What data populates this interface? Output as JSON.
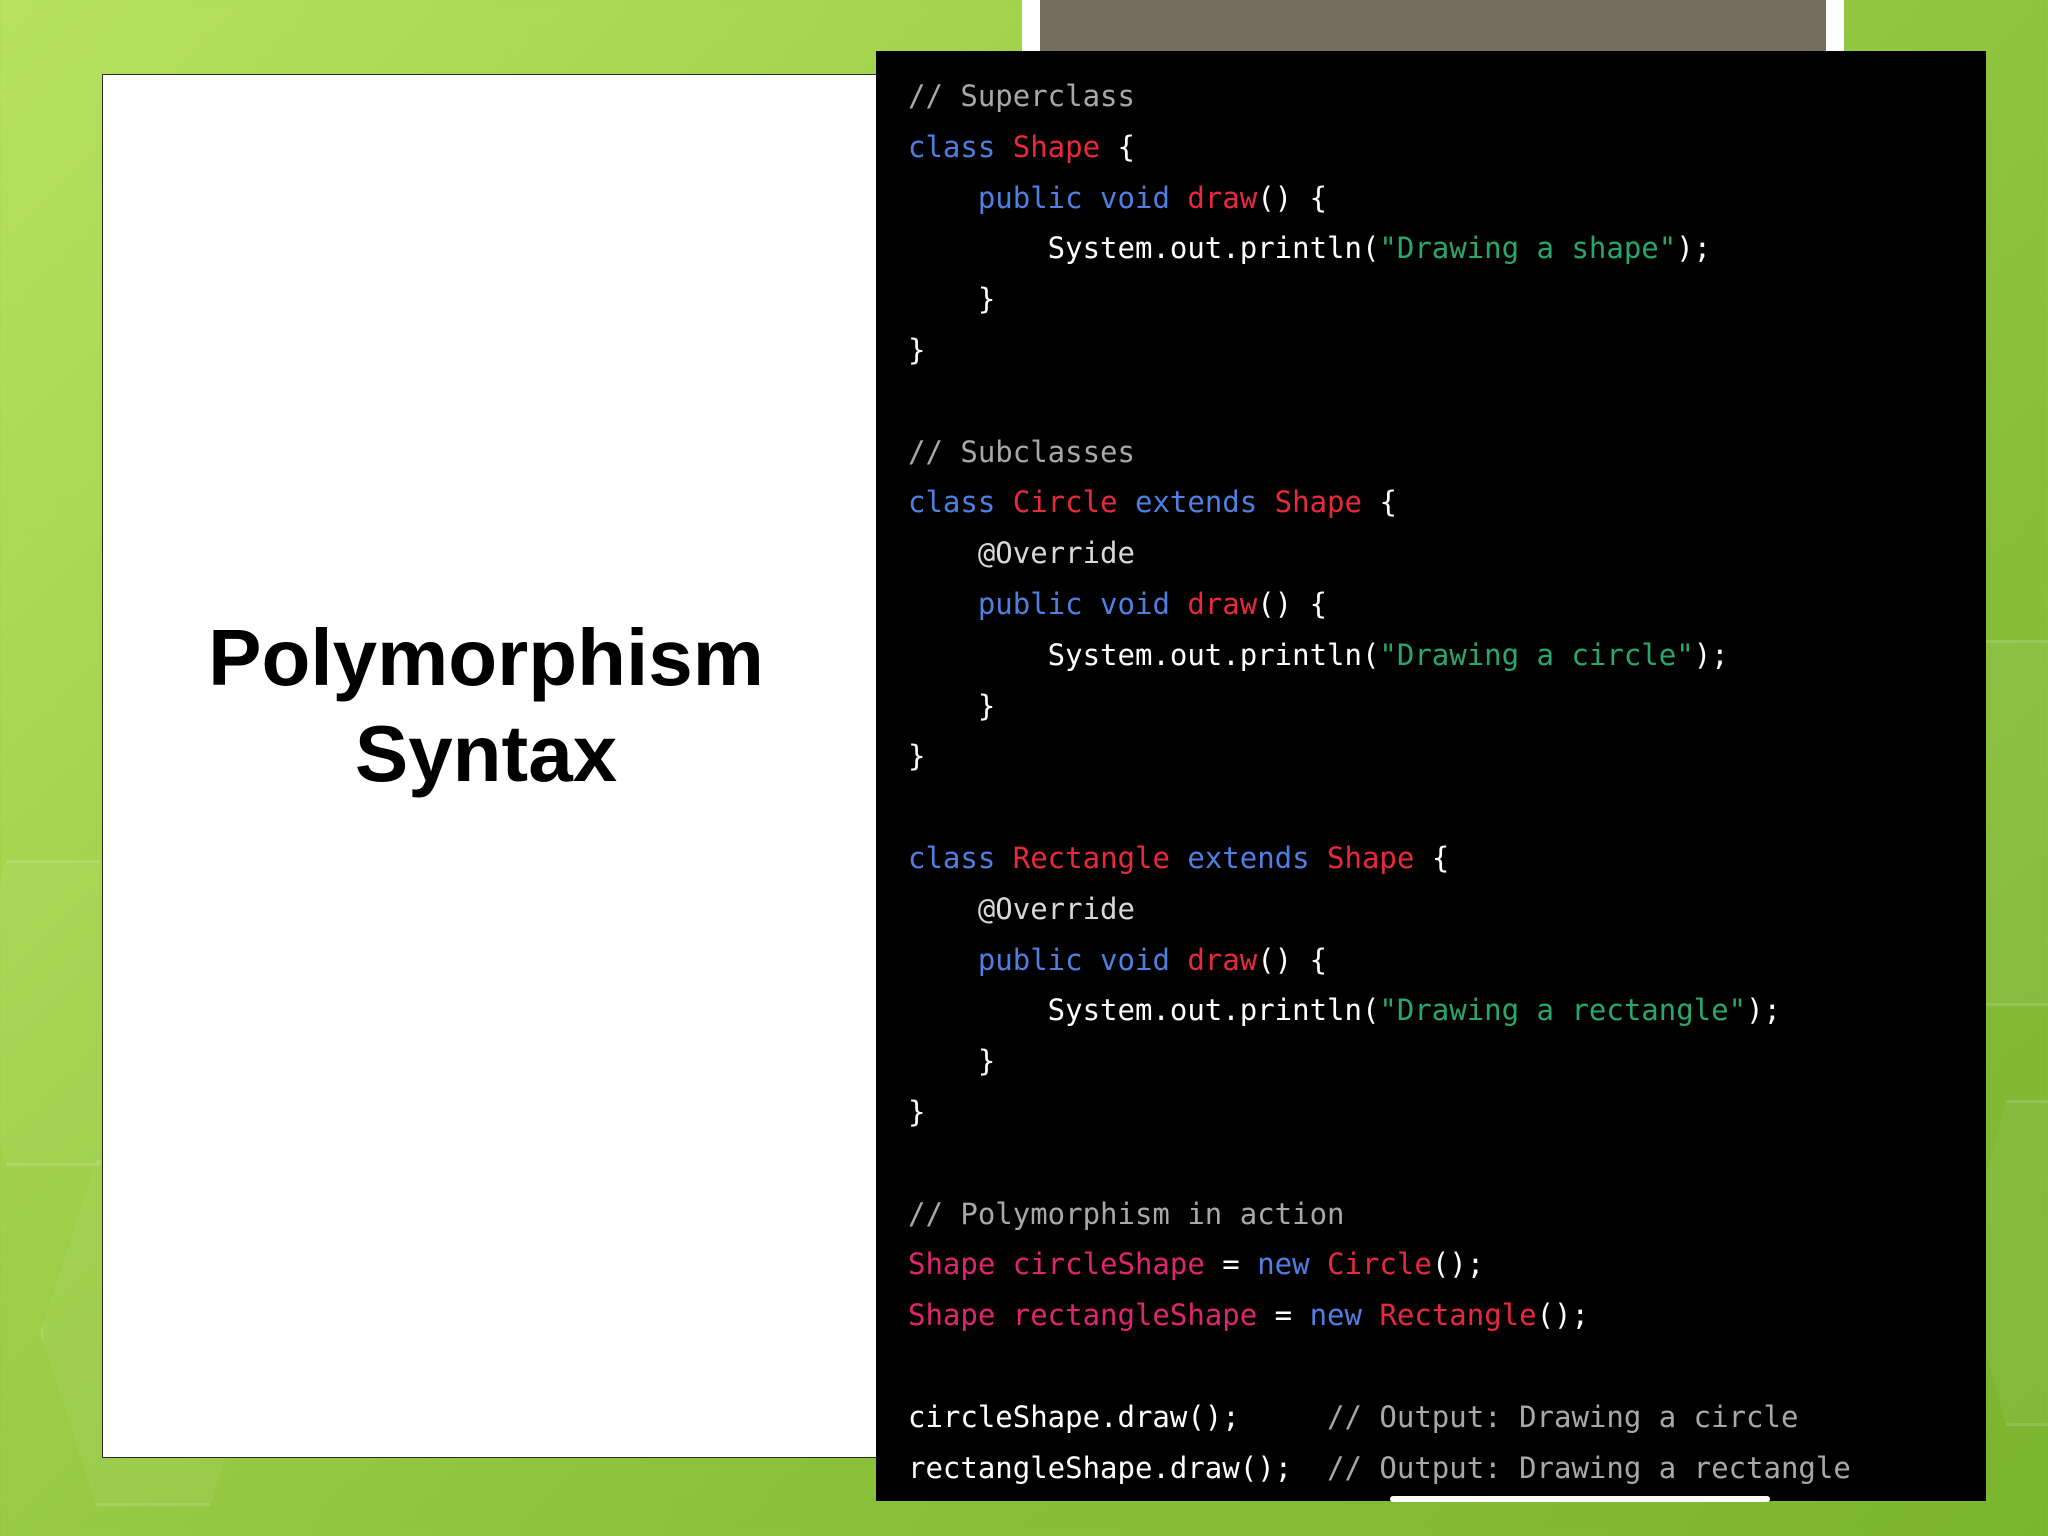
{
  "slide": {
    "title_lines": [
      "Polymorphism",
      "Syntax"
    ]
  },
  "code": {
    "lines": [
      [
        {
          "t": "// Superclass",
          "c": "comment"
        }
      ],
      [
        {
          "t": "class ",
          "c": "kw"
        },
        {
          "t": "Shape",
          "c": "type"
        },
        {
          "t": " {",
          "c": "plain"
        }
      ],
      [
        {
          "t": "    ",
          "c": "plain"
        },
        {
          "t": "public void ",
          "c": "kw"
        },
        {
          "t": "draw",
          "c": "fn"
        },
        {
          "t": "() {",
          "c": "plain"
        }
      ],
      [
        {
          "t": "        System.out.println(",
          "c": "plain"
        },
        {
          "t": "\"Drawing a shape\"",
          "c": "str"
        },
        {
          "t": ");",
          "c": "plain"
        }
      ],
      [
        {
          "t": "    }",
          "c": "plain"
        }
      ],
      [
        {
          "t": "}",
          "c": "plain"
        }
      ],
      [],
      [
        {
          "t": "// Subclasses",
          "c": "comment"
        }
      ],
      [
        {
          "t": "class ",
          "c": "kw"
        },
        {
          "t": "Circle",
          "c": "type"
        },
        {
          "t": " extends ",
          "c": "kw"
        },
        {
          "t": "Shape",
          "c": "type"
        },
        {
          "t": " {",
          "c": "plain"
        }
      ],
      [
        {
          "t": "    @Override",
          "c": "ann"
        }
      ],
      [
        {
          "t": "    ",
          "c": "plain"
        },
        {
          "t": "public void ",
          "c": "kw"
        },
        {
          "t": "draw",
          "c": "fn"
        },
        {
          "t": "() {",
          "c": "plain"
        }
      ],
      [
        {
          "t": "        System.out.println(",
          "c": "plain"
        },
        {
          "t": "\"Drawing a circle\"",
          "c": "str"
        },
        {
          "t": ");",
          "c": "plain"
        }
      ],
      [
        {
          "t": "    }",
          "c": "plain"
        }
      ],
      [
        {
          "t": "}",
          "c": "plain"
        }
      ],
      [],
      [
        {
          "t": "class ",
          "c": "kw"
        },
        {
          "t": "Rectangle",
          "c": "type"
        },
        {
          "t": " extends ",
          "c": "kw"
        },
        {
          "t": "Shape",
          "c": "type"
        },
        {
          "t": " {",
          "c": "plain"
        }
      ],
      [
        {
          "t": "    @Override",
          "c": "ann"
        }
      ],
      [
        {
          "t": "    ",
          "c": "plain"
        },
        {
          "t": "public void ",
          "c": "kw"
        },
        {
          "t": "draw",
          "c": "fn"
        },
        {
          "t": "() {",
          "c": "plain"
        }
      ],
      [
        {
          "t": "        System.out.println(",
          "c": "plain"
        },
        {
          "t": "\"Drawing a rectangle\"",
          "c": "str"
        },
        {
          "t": ");",
          "c": "plain"
        }
      ],
      [
        {
          "t": "    }",
          "c": "plain"
        }
      ],
      [
        {
          "t": "}",
          "c": "plain"
        }
      ],
      [],
      [
        {
          "t": "// Polymorphism in action",
          "c": "comment"
        }
      ],
      [
        {
          "t": "Shape circleShape",
          "c": "var"
        },
        {
          "t": " = ",
          "c": "plain"
        },
        {
          "t": "new ",
          "c": "kw"
        },
        {
          "t": "Circle",
          "c": "type"
        },
        {
          "t": "();",
          "c": "plain"
        }
      ],
      [
        {
          "t": "Shape rectangleShape",
          "c": "var"
        },
        {
          "t": " = ",
          "c": "plain"
        },
        {
          "t": "new ",
          "c": "kw"
        },
        {
          "t": "Rectangle",
          "c": "type"
        },
        {
          "t": "();",
          "c": "plain"
        }
      ],
      [],
      [
        {
          "t": "circleShape.draw();     ",
          "c": "plain"
        },
        {
          "t": "// Output: Drawing a circle",
          "c": "comment"
        }
      ],
      [
        {
          "t": "rectangleShape.draw();  ",
          "c": "plain"
        },
        {
          "t": "// Output: Drawing a rectangle",
          "c": "comment"
        }
      ]
    ]
  }
}
